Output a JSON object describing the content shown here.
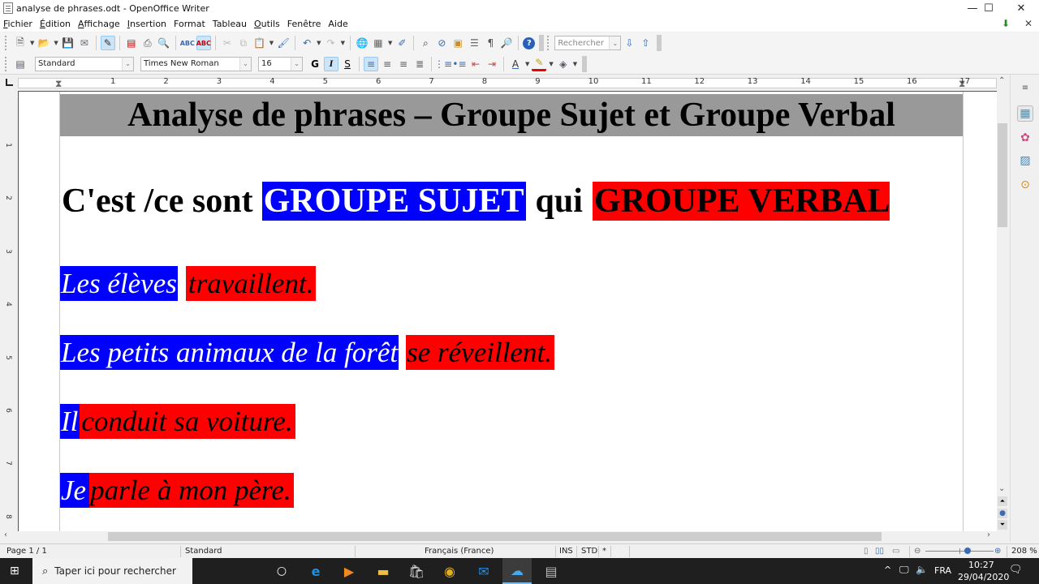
{
  "window": {
    "title": "analyse de phrases.odt - OpenOffice Writer",
    "controls": {
      "minimize": "—",
      "maximize": "☐",
      "close": "✕"
    }
  },
  "menubar": {
    "items": [
      {
        "label": "Fichier",
        "accel": "F",
        "rest": "ichier"
      },
      {
        "label": "Édition",
        "accel": "É",
        "rest": "dition"
      },
      {
        "label": "Affichage",
        "accel": "A",
        "rest": "ffichage"
      },
      {
        "label": "Insertion",
        "accel": "I",
        "rest": "nsertion"
      },
      {
        "label": "Format",
        "accel": "",
        "rest": "Format"
      },
      {
        "label": "Tableau",
        "accel": "",
        "rest": "Tableau"
      },
      {
        "label": "Outils",
        "accel": "O",
        "rest": "utils"
      },
      {
        "label": "Fenêtre",
        "accel": "",
        "rest": "Fenêtre"
      },
      {
        "label": "Aide",
        "accel": "",
        "rest": "Aide"
      }
    ],
    "close_doc": "✕"
  },
  "toolbar_standard": {
    "find_placeholder": "Rechercher",
    "icons": [
      "new-document",
      "open-folder",
      "save",
      "email",
      "edit-mode",
      "export-pdf",
      "print",
      "page-preview",
      "spellcheck",
      "autospellcheck",
      "cut",
      "copy",
      "paste",
      "clone-format",
      "undo",
      "redo",
      "hyperlink",
      "table",
      "draw-functions",
      "find-replace",
      "navigator",
      "gallery",
      "data-sources",
      "nonprinting-chars",
      "zoom",
      "help"
    ]
  },
  "toolbar_formatting": {
    "paragraph_style": "Standard",
    "font_name": "Times New Roman",
    "font_size": "16",
    "bold_label": "G",
    "italic_label": "I",
    "shadow_label": "S"
  },
  "ruler": {
    "h_numbers": [
      "1",
      "2",
      "3",
      "4",
      "5",
      "6",
      "7",
      "8",
      "9",
      "10",
      "11",
      "12",
      "13",
      "14",
      "15",
      "16",
      "17"
    ],
    "v_numbers": [
      "1",
      "2",
      "3",
      "4",
      "5",
      "6",
      "7",
      "8"
    ]
  },
  "document": {
    "heading": "Analyse de phrases – Groupe Sujet et Groupe Verbal",
    "definition": {
      "prefix": "C'est /ce sont",
      "subject": "GROUPE SUJET",
      "middle": "qui",
      "verb": "GROUPE VERBAL"
    },
    "sentences": [
      {
        "subject": "Les élèves",
        "verb": "travaillent."
      },
      {
        "subject": "Les petits animaux de la forêt",
        "verb": "se réveillent."
      },
      {
        "subject": "Il",
        "verb": "conduit sa voiture."
      },
      {
        "subject": "Je",
        "verb": "parle à mon père."
      }
    ],
    "colors": {
      "subject_bg": "#0000ff",
      "verb_bg": "#ff0000",
      "heading_bg": "#999999"
    }
  },
  "statusbar": {
    "page": "Page 1 / 1",
    "style": "Standard",
    "language": "Français (France)",
    "insert_mode": "INS",
    "selection_mode": "STD",
    "modified": "*",
    "zoom": "208 %",
    "zoom_slider_percent": 62
  },
  "taskbar": {
    "search_placeholder": "Taper ici pour rechercher",
    "language": "FRA",
    "time": "10:27",
    "date": "29/04/2020"
  }
}
